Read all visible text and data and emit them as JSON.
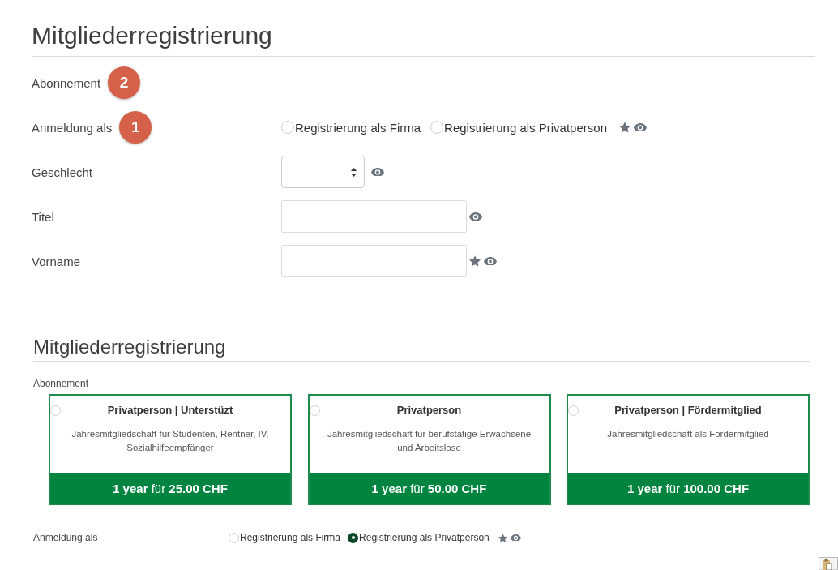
{
  "form_large": {
    "title": "Mitgliederregistrierung",
    "fields": [
      {
        "kind": "heading",
        "label": "Abonnement",
        "badge": "2"
      },
      {
        "kind": "radio",
        "label": "Anmeldung als",
        "badge": "1",
        "required": true,
        "options": [
          {
            "label": "Registrierung als Firma",
            "selected": false
          },
          {
            "label": "Registrierung als Privatperson",
            "selected": false
          }
        ]
      },
      {
        "kind": "select",
        "label": "Geschlecht",
        "required": false
      },
      {
        "kind": "text",
        "label": "Titel",
        "required": false
      },
      {
        "kind": "text",
        "label": "Vorname",
        "required": true
      }
    ]
  },
  "form_compact": {
    "title": "Mitgliederregistrierung",
    "subscription_label": "Abonnement",
    "plans": [
      {
        "title": "Privatperson | Unterstüzt",
        "description": "Jahresmitgliedschaft für Studenten, Rentner, IV, Sozialhilfeempfänger",
        "price": "**1 year** für **25.00 CHF**",
        "selected": false
      },
      {
        "title": "Privatperson",
        "description": "Jahresmitgliedschaft für berufstätige Erwachsene und Arbeitslose",
        "price": "**1 year** für **50.00 CHF**",
        "selected": false
      },
      {
        "title": "Privatperson | Fördermitglied",
        "description": "Jahresmitgliedschaft als Fördermitglied",
        "price": "**1 year** für **100.00 CHF**",
        "selected": false
      }
    ],
    "fields": [
      {
        "kind": "radio",
        "label": "Anmeldung als",
        "required": true,
        "options": [
          {
            "label": "Registrierung als Firma",
            "selected": false
          },
          {
            "label": "Registrierung als Privatperson",
            "selected": true
          }
        ]
      }
    ]
  }
}
